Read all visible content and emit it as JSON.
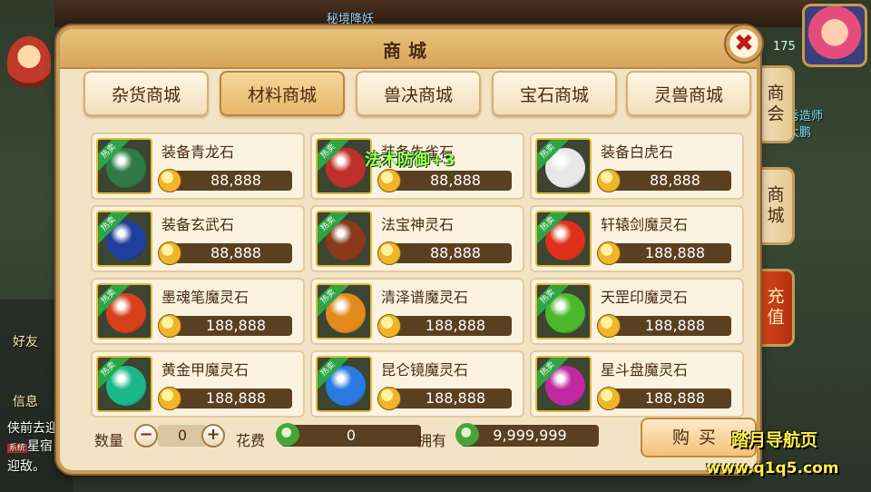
{
  "background": {
    "map_banner": "秘境降妖",
    "left_labels": [
      "好友",
      "信息"
    ],
    "chat_lines": [
      "侠前去迎",
      "星宿",
      "迎敌。"
    ],
    "chat_tag": "系统",
    "counter": "175",
    "hero_labels": [
      "秀造师",
      "大鹏"
    ]
  },
  "panel": {
    "title": "商城",
    "close_icon": "✖"
  },
  "tabs": [
    {
      "label": "杂货商城"
    },
    {
      "label": "材料商城"
    },
    {
      "label": "兽决商城"
    },
    {
      "label": "宝石商城"
    },
    {
      "label": "灵兽商城"
    }
  ],
  "side_tabs": [
    {
      "label": "商会"
    },
    {
      "label": "商城"
    },
    {
      "label": "充值"
    }
  ],
  "hot_badge": "热卖",
  "items": [
    {
      "name": "装备青龙石",
      "price": "88,888",
      "color": "#2f7a45"
    },
    {
      "name": "装备朱雀石",
      "price": "88,888",
      "color": "#c0302a"
    },
    {
      "name": "装备白虎石",
      "price": "88,888",
      "color": "#e8e8e8"
    },
    {
      "name": "装备玄武石",
      "price": "88,888",
      "color": "#203f9a"
    },
    {
      "name": "法宝神灵石",
      "price": "88,888",
      "color": "#8a3a1a"
    },
    {
      "name": "轩辕剑魔灵石",
      "price": "188,888",
      "color": "#e0301a"
    },
    {
      "name": "墨魂笔魔灵石",
      "price": "188,888",
      "color": "#d8401a"
    },
    {
      "name": "清泽谱魔灵石",
      "price": "188,888",
      "color": "#e28a1a"
    },
    {
      "name": "天罡印魔灵石",
      "price": "188,888",
      "color": "#4ab82a"
    },
    {
      "name": "黄金甲魔灵石",
      "price": "188,888",
      "color": "#1ab88a"
    },
    {
      "name": "昆仑镜魔灵石",
      "price": "188,888",
      "color": "#2a7ae2"
    },
    {
      "name": "星斗盘魔灵石",
      "price": "188,888",
      "color": "#c02aa0"
    }
  ],
  "floating_text": "法术防御+3",
  "bottom": {
    "qty_label": "数量",
    "qty_value": "0",
    "minus": "−",
    "plus": "+",
    "cost_label": "花费",
    "cost_value": "0",
    "own_label": "拥有",
    "own_value": "9,999,999",
    "buy_label": "购买"
  },
  "watermark": {
    "line1": "踏月导航页",
    "line2": "www.q1q5.com"
  }
}
